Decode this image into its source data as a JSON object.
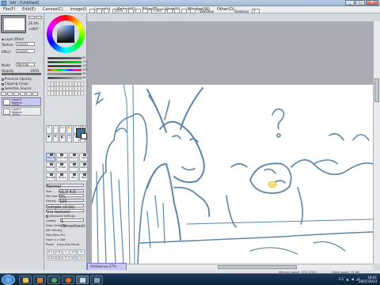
{
  "window": {
    "title": "SAI - [Untitled]",
    "controls": [
      "_",
      "□",
      "×"
    ]
  },
  "menu": [
    "File(F)",
    "Edit(E)",
    "Canvas(C)",
    "Image(I)",
    "Layer(L)",
    "Select(S)",
    "Filter(T)",
    "View(V)",
    "Window(W)",
    "Other(O)"
  ],
  "toolbar": {
    "zoom_value": "100%",
    "angle_value": "+000°",
    "selection_label": "Selection",
    "stabilizer_label": "Stabilizer",
    "stabilizer_value": "3"
  },
  "navigator": {
    "zoom": "26.6%",
    "angle": "+000°"
  },
  "layer_props": {
    "texture_label": "Texture",
    "texture_value": "(none)",
    "effect_label": "Effect",
    "effect_value": "(none)",
    "mode_label": "Mode",
    "mode_value": "Normal",
    "opacity_label": "Opacity",
    "opacity_value": "100%",
    "checks": [
      "Preserve Opacity",
      "Clipping Group",
      "Selection Source"
    ]
  },
  "layers": [
    {
      "name": "Layer2",
      "mode": "Normal",
      "opacity": "100%",
      "selected": true
    },
    {
      "name": "Layer1",
      "mode": "Normal",
      "opacity": "100%",
      "selected": false
    }
  ],
  "color": {
    "sliders": [
      {
        "label": "R",
        "value": "61",
        "color": "#d33"
      },
      {
        "label": "G",
        "value": "111",
        "color": "#3b3"
      },
      {
        "label": "B",
        "value": "147",
        "color": "#33d"
      },
      {
        "label": "H",
        "value": "205",
        "color": "#aaa"
      },
      {
        "label": "S",
        "value": "59",
        "color": "#aaa"
      },
      {
        "label": "V",
        "value": "58",
        "color": "#aaa"
      }
    ],
    "primary": "#3d6f93",
    "secondary": "#ffffff"
  },
  "tools_row": [
    "↖",
    "◌",
    "▭",
    "✋",
    "🔍",
    "⟲",
    "✚",
    "✎",
    "◧",
    "▢",
    "≡",
    "⟡"
  ],
  "brushes": [
    {
      "label": "Pencil",
      "on": true
    },
    {
      "label": "AirBrush",
      "on": false
    },
    {
      "label": "Brush",
      "on": false
    },
    {
      "label": "Water",
      "on": false
    },
    {
      "label": "Marker",
      "on": false
    },
    {
      "label": "Eraser",
      "on": false
    },
    {
      "label": "SelPen",
      "on": false
    },
    {
      "label": "SelErase",
      "on": false
    },
    {
      "label": "Bucket",
      "on": false
    },
    {
      "label": "Binary",
      "on": false
    },
    {
      "label": "Blur",
      "on": false
    },
    {
      "label": "Blend",
      "on": false
    }
  ],
  "brush_props": {
    "mode_value": "Normal",
    "size_label": "Size",
    "size_value": "x1.0  4.0",
    "min_size_label": "Min Size",
    "min_size_value": "0%",
    "density_label": "Density",
    "density_value": "100",
    "shape_value": "(simple circle)",
    "texture_value": "(no texture)",
    "adv_label": "Advanced Settings",
    "quality_label": "Quality",
    "quality_value": "1 (Smoothest)",
    "edge_label": "Edge Hardness",
    "min_density_label": "Min Density",
    "max_dens_prs_label": "Max Dens Prs.",
    "hard_soft_label": "Hard <-> Soft",
    "press_label": "Press:",
    "press_opts": "Dens  Size  Blend"
  },
  "size_presets": [
    "0.7",
    "0.8",
    "1",
    "1.5",
    "2",
    "2.3",
    "2.6",
    "3",
    "3.5",
    "4"
  ],
  "tabs": {
    "doc_tab": "Untitled.sai  27%"
  },
  "status": {
    "memory": "Memory usage: 17% (33%)",
    "drive": "Drive space: 79 GB"
  },
  "taskbar": {
    "tray": "ES ▲ ◀ 🔊",
    "time": "18:41",
    "date": "26/07/2013"
  }
}
